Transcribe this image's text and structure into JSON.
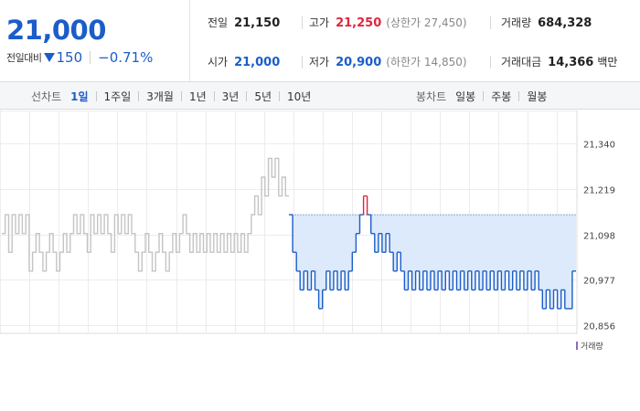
{
  "quote": {
    "price": "21,000",
    "change_label": "전일대비",
    "change_amount": "150",
    "change_percent": "−0.71%",
    "stats": {
      "prev_close": {
        "label": "전일",
        "value": "21,150"
      },
      "high": {
        "label": "고가",
        "value": "21,250",
        "sub": "(상한가 27,450)"
      },
      "volume": {
        "label": "거래량",
        "value": "684,328"
      },
      "open": {
        "label": "시가",
        "value": "21,000"
      },
      "low": {
        "label": "저가",
        "value": "20,900",
        "sub": "(하한가 14,850)"
      },
      "trade_value": {
        "label": "거래대금",
        "value": "14,366",
        "unit": "백만"
      }
    }
  },
  "tabs": {
    "line_title": "선차트",
    "line_tabs": [
      "1일",
      "1주일",
      "3개월",
      "1년",
      "3년",
      "5년",
      "10년"
    ],
    "line_active": 0,
    "candle_title": "봉차트",
    "candle_tabs": [
      "일봉",
      "주봉",
      "월봉"
    ]
  },
  "colors": {
    "up": "#e0263a",
    "down": "#1b5dc9",
    "flat_gray": "#c4c4c4",
    "area_fill": "#ddeafb",
    "volume": "#8c70b5"
  },
  "chart_data": {
    "type": "line",
    "title": "",
    "xlabel": "",
    "ylabel": "",
    "ylim": [
      20856,
      21340
    ],
    "y_ticks": [
      "21,340",
      "21,219",
      "21,098",
      "20,977",
      "20,856"
    ],
    "grid": true,
    "reference_price": 21150,
    "legend": [
      {
        "label": "거래량",
        "placement": "bottom-right"
      }
    ],
    "series": [
      {
        "segment": "previous-day",
        "values": [
          21100,
          21150,
          21050,
          21150,
          21100,
          21150,
          21100,
          21150,
          21000,
          21050,
          21100,
          21050,
          21000,
          21050,
          21100,
          21050,
          21000,
          21050,
          21100,
          21050,
          21100,
          21150,
          21100,
          21150,
          21100,
          21050,
          21150,
          21100,
          21150,
          21100,
          21150,
          21100,
          21050,
          21150,
          21100,
          21150,
          21100,
          21150,
          21100,
          21050,
          21000,
          21050,
          21100,
          21050,
          21000,
          21050,
          21100,
          21050,
          21000,
          21050,
          21100,
          21050,
          21100,
          21150,
          21100,
          21050,
          21100,
          21050,
          21100,
          21050,
          21100,
          21050,
          21100,
          21050,
          21100,
          21050,
          21100,
          21050,
          21100,
          21050,
          21100,
          21050,
          21100,
          21150,
          21200,
          21150,
          21250,
          21200,
          21300,
          21250,
          21300,
          21200,
          21250,
          21200
        ]
      },
      {
        "segment": "today",
        "values": [
          21150,
          21050,
          21000,
          20950,
          21000,
          20950,
          21000,
          20950,
          20900,
          20950,
          21000,
          20950,
          21000,
          20950,
          21000,
          20950,
          21000,
          21050,
          21100,
          21150,
          21200,
          21150,
          21100,
          21050,
          21100,
          21050,
          21100,
          21050,
          21000,
          21050,
          21000,
          20950,
          21000,
          20950,
          21000,
          20950,
          21000,
          20950,
          21000,
          20950,
          21000,
          20950,
          21000,
          20950,
          21000,
          20950,
          21000,
          20950,
          21000,
          20950,
          21000,
          20950,
          21000,
          20950,
          21000,
          20950,
          21000,
          20950,
          21000,
          20950,
          21000,
          20950,
          21000,
          20950,
          21000,
          20950,
          21000,
          20950,
          20900,
          20950,
          20900,
          20950,
          20900,
          20950,
          20900,
          20900,
          21000
        ]
      }
    ]
  }
}
